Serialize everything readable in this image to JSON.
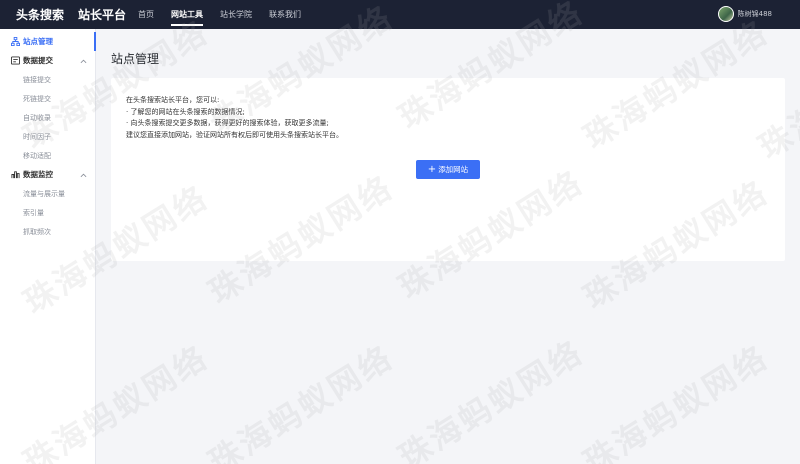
{
  "brand": {
    "name": "头条搜索",
    "subtitle": "站长平台"
  },
  "nav": [
    {
      "label": "首页",
      "active": false
    },
    {
      "label": "网站工具",
      "active": true
    },
    {
      "label": "站长学院",
      "active": false
    },
    {
      "label": "联系我们",
      "active": false
    }
  ],
  "user": {
    "name": "陈树锦488"
  },
  "sidebar": {
    "site_manage": "站点管理",
    "data_submit": {
      "label": "数据提交",
      "items": [
        "链接提交",
        "死链提交",
        "自动收录",
        "时间因子",
        "移动适配"
      ]
    },
    "data_monitor": {
      "label": "数据监控",
      "items": [
        "流量与展示量",
        "索引量",
        "抓取频次"
      ]
    }
  },
  "main": {
    "title": "站点管理",
    "intro": [
      "在头条搜索站长平台，您可以:",
      "· 了解您的网站在头条搜索的数据情况;",
      "· 向头条搜索提交更多数据，获得更好的搜索体验，获取更多流量;",
      "建议您直接添加网站，验证网站所有权后即可使用头条搜索站长平台。"
    ],
    "add_button": "添加网站"
  },
  "watermark": "珠海蚂蚁网络",
  "colors": {
    "accent": "#3b6ff5",
    "topbar": "#1c2234",
    "background": "#f4f5f8"
  }
}
